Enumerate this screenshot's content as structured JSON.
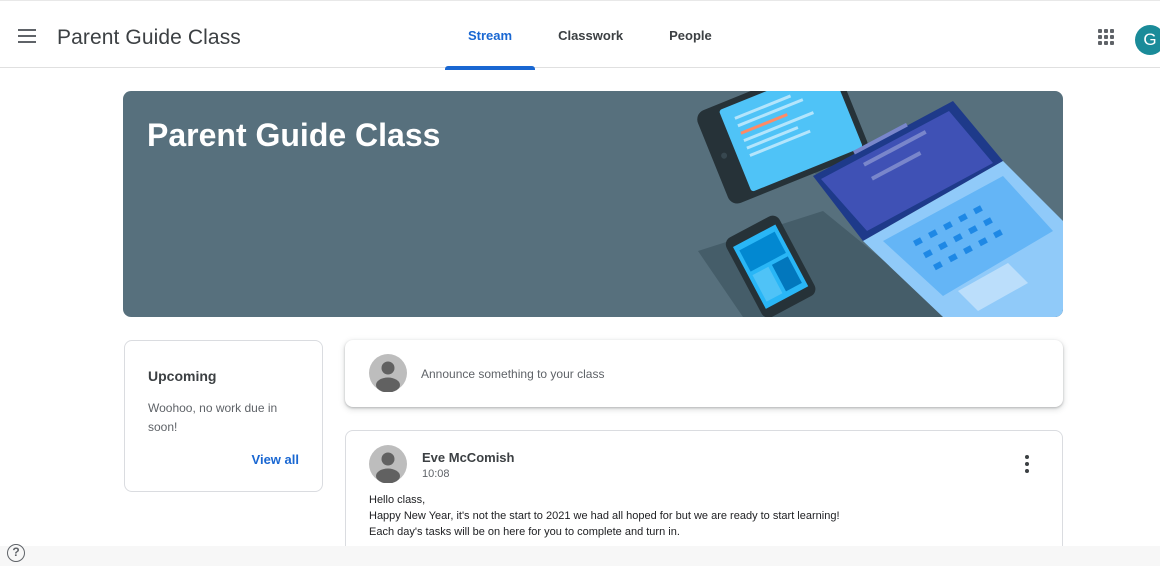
{
  "header": {
    "app_title": "Parent Guide Class",
    "tabs": [
      {
        "label": "Stream",
        "active": true
      },
      {
        "label": "Classwork",
        "active": false
      },
      {
        "label": "People",
        "active": false
      }
    ],
    "account_initial": "G",
    "account_color": "#1a8b99",
    "accent_color": "#1967d2"
  },
  "banner": {
    "title": "Parent Guide Class",
    "background_color": "#57707d"
  },
  "upcoming": {
    "title": "Upcoming",
    "text": "Woohoo, no work due in soon!",
    "link_label": "View all"
  },
  "announce": {
    "placeholder": "Announce something to your class"
  },
  "post": {
    "author": "Eve McComish",
    "time": "10:08",
    "lines": [
      "Hello class,",
      "Happy New Year, it's not the start to 2021 we had all hoped for but we are ready to start learning!",
      "Each day's tasks will be on here for you to complete and turn in."
    ]
  },
  "icons": {
    "menu": "hamburger-menu-icon",
    "apps": "google-apps-grid-icon",
    "more": "more-vert-icon",
    "help": "help-icon",
    "help_glyph": "?"
  }
}
